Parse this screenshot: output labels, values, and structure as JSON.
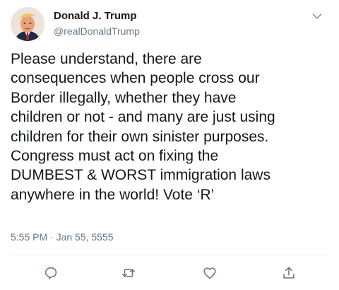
{
  "tweet": {
    "author_name": "Donald J. Trump",
    "handle": "@realDonaldTrump",
    "text": "Please understand, there are\nconsequences when people cross our\nBorder illegally, whether they have\nchildren or not - and many are just using\nchildren for their own sinister purposes.\nCongress must act on fixing the\nDUMBEST & WORST immigration laws\nanywhere in the world! Vote ‘R’",
    "timestamp": "5:55 PM · Jan 55, 5555"
  },
  "icons": {
    "menu": "chevron-down-icon",
    "reply": "reply-icon",
    "retweet": "retweet-icon",
    "like": "heart-icon",
    "share": "share-icon"
  },
  "colors": {
    "text": "#14171a",
    "secondary": "#657786",
    "divider": "#e6ecf0"
  }
}
